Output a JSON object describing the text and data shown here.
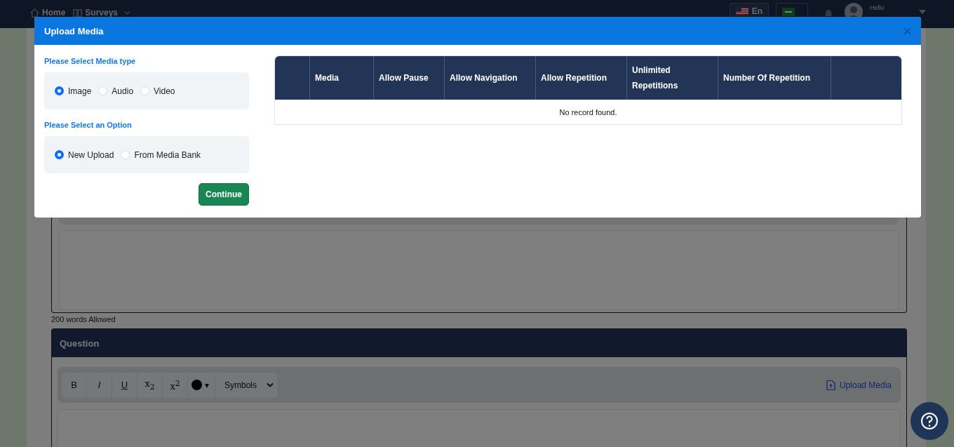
{
  "nav": {
    "items": [
      {
        "label": "Home",
        "kind": "home"
      },
      {
        "label": "Surveys",
        "kind": "surveys"
      }
    ],
    "language": "En",
    "greeting": "Hello"
  },
  "editor_top": {
    "word_limit": "200 words Allowed"
  },
  "question": {
    "title": "Question",
    "toolbar": [
      {
        "kind": "bold",
        "label": "B"
      },
      {
        "kind": "italic",
        "label": "I"
      },
      {
        "kind": "underline",
        "label": "U"
      },
      {
        "kind": "script",
        "label": "x$_{2}$"
      },
      {
        "kind": "script",
        "label": "x$^{2}$"
      },
      {
        "kind": "color",
        "label": "▾",
        "color": "#000000"
      }
    ],
    "symbols": "Symbols",
    "upload": "Upload Media"
  },
  "modal": {
    "title": "Upload Media",
    "groups": [
      {
        "label": "Please Select Media type",
        "options": [
          {
            "label": "Image",
            "selected": true
          },
          {
            "label": "Audio",
            "selected": false
          },
          {
            "label": "Video",
            "selected": false
          }
        ]
      },
      {
        "label": "Please Select an Option",
        "options": [
          {
            "label": "New Upload",
            "selected": true
          },
          {
            "label": "From Media Bank",
            "selected": false
          }
        ]
      }
    ],
    "continue": "Continue",
    "table": {
      "columns": [
        "",
        "Media",
        "Allow Pause",
        "Allow Navigation",
        "Allow Repetition",
        "Unlimited Repetitions",
        "Number Of Repetition",
        ""
      ],
      "empty": "No record found."
    }
  }
}
